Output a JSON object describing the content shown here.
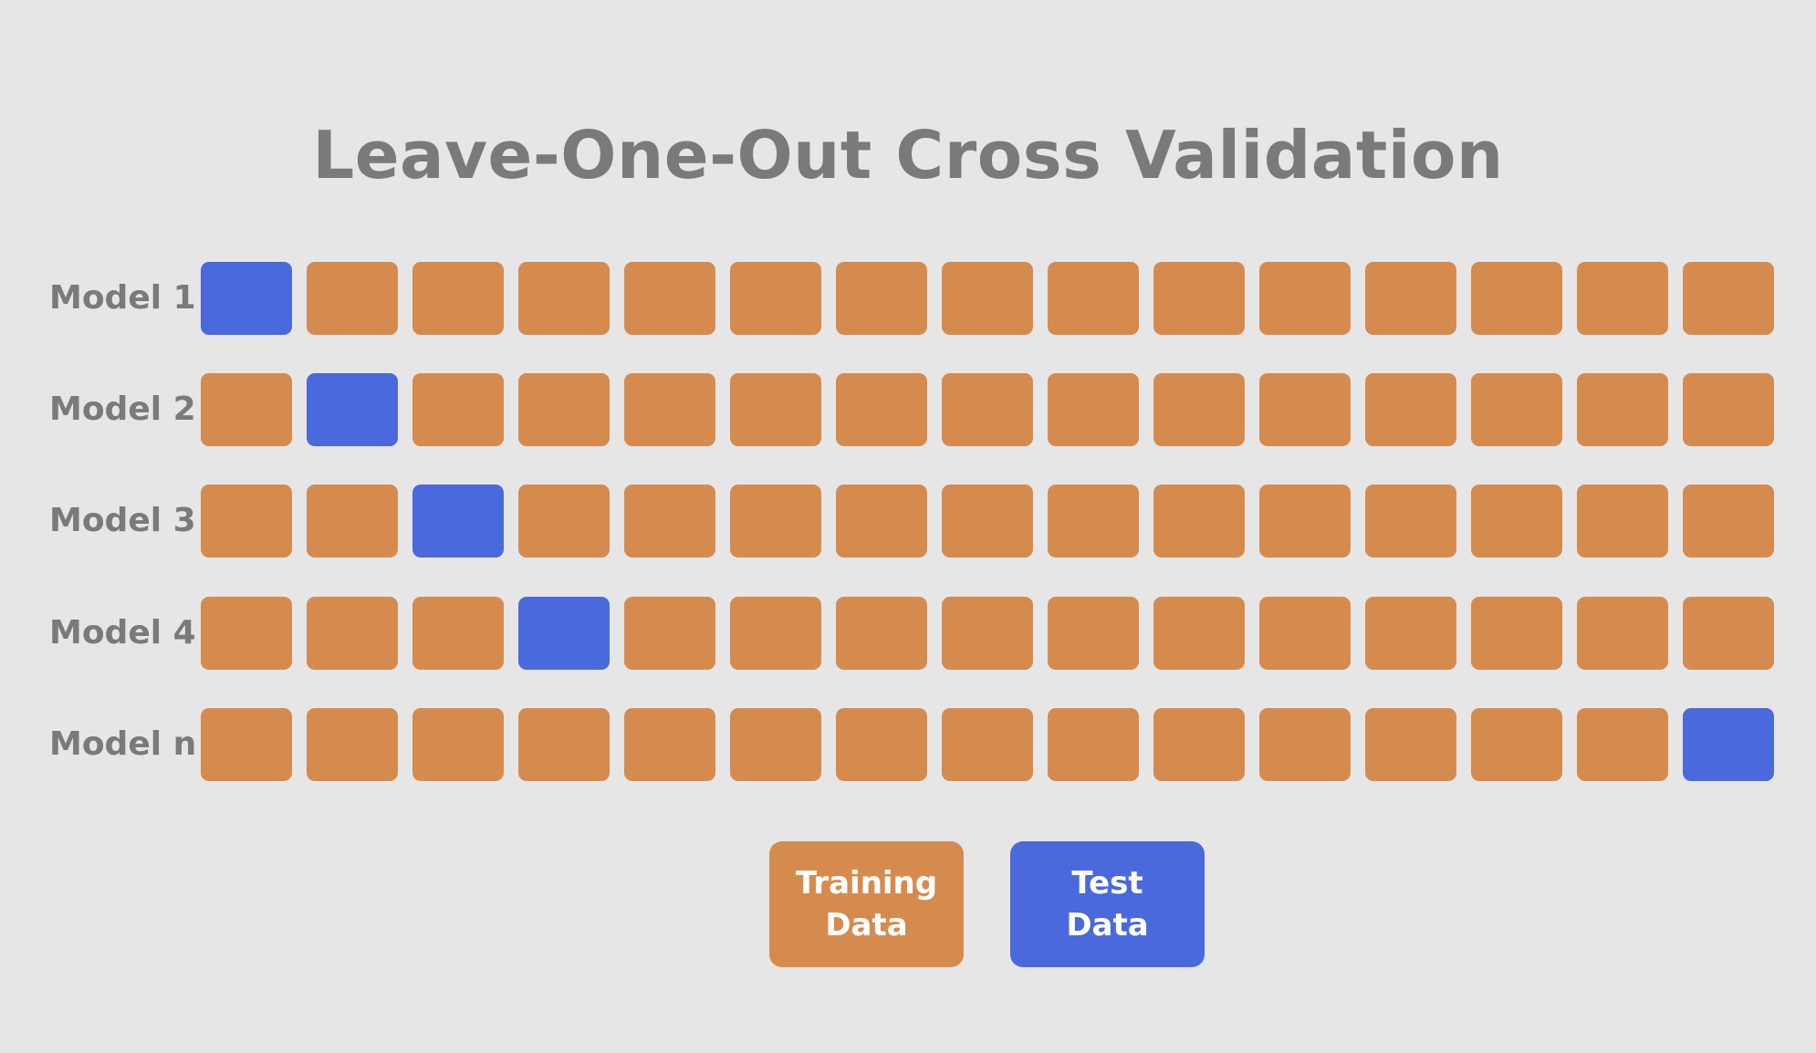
{
  "title": "Leave-One-Out Cross Validation",
  "colors": {
    "training": "#d68b4e",
    "test": "#4a69dd"
  },
  "columns": 15,
  "rows": [
    {
      "label": "Model 1",
      "test_index": 0
    },
    {
      "label": "Model 2",
      "test_index": 1
    },
    {
      "label": "Model 3",
      "test_index": 2
    },
    {
      "label": "Model 4",
      "test_index": 3
    },
    {
      "label": "Model n",
      "test_index": 14
    }
  ],
  "legend": {
    "training": {
      "line1": "Training",
      "line2": "Data"
    },
    "test": {
      "line1": "Test",
      "line2": "Data"
    }
  }
}
